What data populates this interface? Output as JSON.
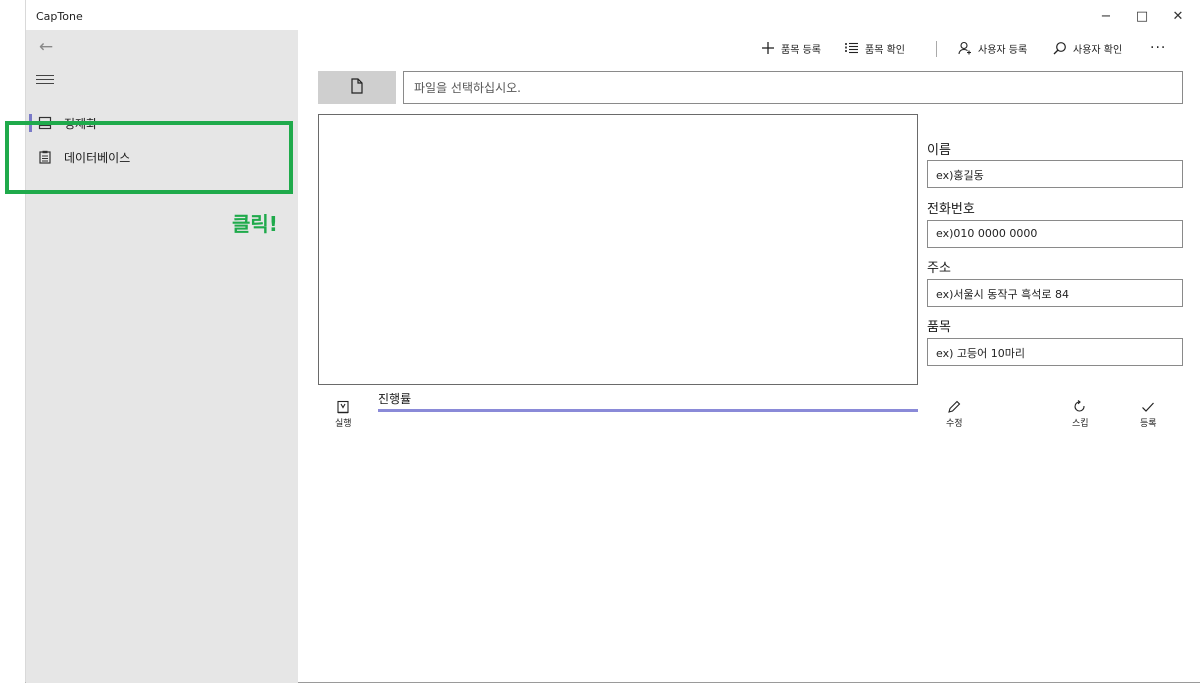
{
  "window": {
    "title": "CapTone",
    "controls": {
      "minimize": "−",
      "maximize": "□",
      "close": "✕"
    }
  },
  "sidebar": {
    "back_icon": "back-arrow-icon",
    "menu_icon": "hamburger-icon",
    "items": [
      {
        "label": "정제화",
        "icon": "cards-icon"
      },
      {
        "label": "데이터베이스",
        "icon": "clipboard-icon"
      }
    ],
    "selection_color": "#7a7ac8"
  },
  "annotation": {
    "text": "클릭!",
    "color": "#1faa4b"
  },
  "commandbar": {
    "items": [
      {
        "label": "품목 등록",
        "icon": "plus-icon"
      },
      {
        "label": "품목 확인",
        "icon": "list-icon"
      },
      {
        "label": "사용자 등록",
        "icon": "add-user-icon"
      },
      {
        "label": "사용자 확인",
        "icon": "search-icon"
      }
    ],
    "more": "···"
  },
  "file": {
    "button_icon": "new-file-icon",
    "placeholder": "파일을 선택하십시오."
  },
  "form": {
    "fields": [
      {
        "label": "이름",
        "value": "ex)홍길동"
      },
      {
        "label": "전화번호",
        "value": "ex)010 0000 0000"
      },
      {
        "label": "주소",
        "value": "ex)서울시 동작구 흑석로 84"
      },
      {
        "label": "품목",
        "value": "ex) 고등어 10마리"
      }
    ]
  },
  "actions": {
    "run": {
      "label": "실행",
      "icon": "run-icon"
    },
    "edit": {
      "label": "수정",
      "icon": "pencil-icon"
    },
    "skip": {
      "label": "스킵",
      "icon": "redo-icon"
    },
    "register": {
      "label": "등록",
      "icon": "check-icon"
    }
  },
  "progress": {
    "label": "진행률",
    "value": 1.0,
    "color": "#8a8ad8"
  }
}
